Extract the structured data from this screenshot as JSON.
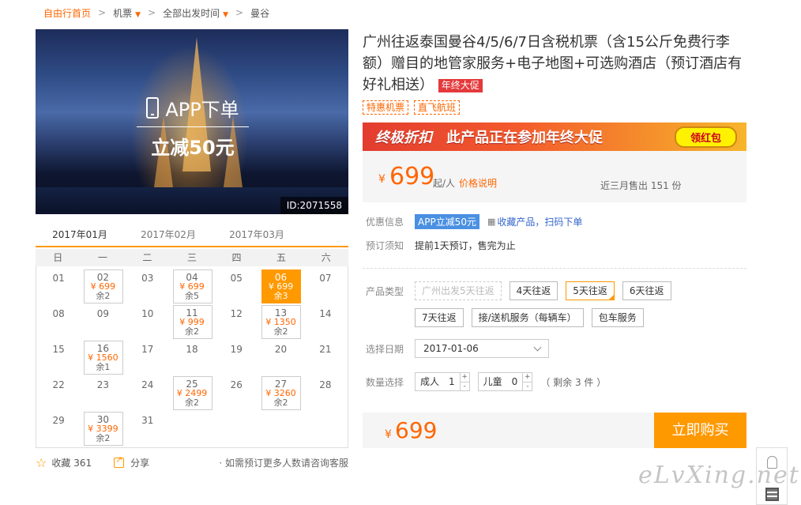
{
  "breadcrumb": {
    "home": "自由行首页",
    "items": [
      "机票",
      "全部出发时间",
      "曼谷"
    ]
  },
  "hero": {
    "promo_line1": "APP下单",
    "promo_line2": "立减50元",
    "product_id": "ID:2071558"
  },
  "calendar": {
    "months": [
      "2017年01月",
      "2017年02月",
      "2017年03月"
    ],
    "active_month": 0,
    "weekdays": [
      "日",
      "一",
      "二",
      "三",
      "四",
      "五",
      "六"
    ],
    "days": [
      {
        "d": "01"
      },
      {
        "d": "02",
        "price": "¥ 699",
        "remain": "余2"
      },
      {
        "d": "03"
      },
      {
        "d": "04",
        "price": "¥ 699",
        "remain": "余5"
      },
      {
        "d": "05"
      },
      {
        "d": "06",
        "price": "¥ 699",
        "remain": "余3",
        "selected": true
      },
      {
        "d": "07"
      },
      {
        "d": "08"
      },
      {
        "d": "09"
      },
      {
        "d": "10"
      },
      {
        "d": "11",
        "price": "¥ 999",
        "remain": "余2"
      },
      {
        "d": "12"
      },
      {
        "d": "13",
        "price": "¥ 1350",
        "remain": "余2"
      },
      {
        "d": "14"
      },
      {
        "d": "15"
      },
      {
        "d": "16",
        "price": "¥ 1560",
        "remain": "余1"
      },
      {
        "d": "17"
      },
      {
        "d": "18"
      },
      {
        "d": "19"
      },
      {
        "d": "20"
      },
      {
        "d": "21"
      },
      {
        "d": "22"
      },
      {
        "d": "23"
      },
      {
        "d": "24"
      },
      {
        "d": "25",
        "price": "¥ 2499",
        "remain": "余2"
      },
      {
        "d": "26"
      },
      {
        "d": "27",
        "price": "¥ 3260",
        "remain": "余2"
      },
      {
        "d": "28"
      },
      {
        "d": "29"
      },
      {
        "d": "30",
        "price": "¥ 3399",
        "remain": "余2"
      },
      {
        "d": "31"
      }
    ]
  },
  "actions": {
    "favorite_label": "收藏",
    "favorite_count": "361",
    "share_label": "分享",
    "note": "· 如需预订更多人数请咨询客服"
  },
  "product": {
    "title": "广州往返泰国曼谷4/5/6/7日含税机票（含15公斤免费行李额）赠目的地管家服务+电子地图+可选购酒店（预订酒店有好礼相送）",
    "promo_tag": "年终大促",
    "tags": [
      "特惠机票",
      "直飞航班"
    ]
  },
  "banner": {
    "left": "终极折扣",
    "mid": "此产品正在参加年终大促",
    "btn": "领红包"
  },
  "price": {
    "currency": "¥",
    "amount": "699",
    "unit": "起/人",
    "explain": "价格说明",
    "sold": "近三月售出 151 份"
  },
  "discount": {
    "label": "优惠信息",
    "badge": "APP立减50元",
    "link": "收藏产品，扫码下单"
  },
  "booking_notice": {
    "label": "预订须知",
    "text": "提前1天预订，售完为止"
  },
  "product_type": {
    "label": "产品类型",
    "row1": [
      "广州出发5天往返",
      "4天往返",
      "5天往返",
      "6天往返"
    ],
    "row2": [
      "7天往返",
      "接/送机服务（每辆车）",
      "包车服务"
    ]
  },
  "date_select": {
    "label": "选择日期",
    "value": "2017-01-06"
  },
  "quantity": {
    "label": "数量选择",
    "adult_label": "成人",
    "adult_value": "1",
    "child_label": "儿童",
    "child_value": "0",
    "remain": "（ 剩余 3 件 ）"
  },
  "buy": {
    "currency": "¥",
    "amount": "699",
    "button": "立即购买"
  },
  "watermark": "eLvXing.net",
  "colors": {
    "accent": "#ff9900",
    "price": "#ff6600",
    "promo_red": "#e4393c",
    "link": "#3366cc"
  }
}
